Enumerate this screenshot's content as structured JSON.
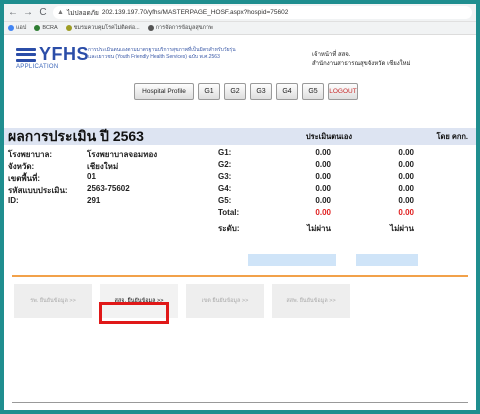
{
  "browser": {
    "nav": [
      "←",
      "→",
      "C"
    ],
    "security": "ไม่ปลอดภัย",
    "url": "202.139.197.70/yfhs/MASTERPAGE_HOSF.aspx?hospid=75602",
    "bookmarks": [
      "แอป",
      "BCRA",
      "ชมรมควบคุมโรคไม่ติดต่อ...",
      "การจัดการข้อมูลสุขภาพ"
    ]
  },
  "header": {
    "logo": "YFHS",
    "logo_sub": "APPLICATION",
    "desc_line1": "การประเมินตนเองตามมาตรฐานบริการสุขภาพที่เป็นมิตรสำหรับวัยรุ่น",
    "desc_line2": "และเยาวชน (Youth Friendly Health Services) ฉบับ พ.ศ.2563",
    "officer_line1": "เจ้าหน้าที่ สสจ.",
    "officer_line2": "สำนักงานสาธารณสุขจังหวัด เชียงใหม่"
  },
  "toolbar": {
    "hospital_profile": "Hospital Profile",
    "g1": "G1",
    "g2": "G2",
    "g3": "G3",
    "g4": "G4",
    "g5": "G5",
    "logout": "LOGOUT"
  },
  "results": {
    "title": "ผลการประเมิน ปี 2563",
    "col_self": "ประเมินตนเอง",
    "col_gov": "โดย คกก.",
    "info": [
      {
        "label": "โรงพยาบาล:",
        "value": "โรงพยาบาลจอมทอง"
      },
      {
        "label": "จังหวัด:",
        "value": "เชียงใหม่"
      },
      {
        "label": "เขตพื้นที่:",
        "value": "01"
      },
      {
        "label": "รหัสแบบประเมิน:",
        "value": "2563-75602"
      },
      {
        "label": "ID:",
        "value": "291"
      }
    ],
    "scores": [
      {
        "label": "G1:",
        "self": "0.00",
        "gov": "0.00"
      },
      {
        "label": "G2:",
        "self": "0.00",
        "gov": "0.00"
      },
      {
        "label": "G3:",
        "self": "0.00",
        "gov": "0.00"
      },
      {
        "label": "G4:",
        "self": "0.00",
        "gov": "0.00"
      },
      {
        "label": "G5:",
        "self": "0.00",
        "gov": "0.00"
      },
      {
        "label": "Total:",
        "self": "0.00",
        "gov": "0.00"
      },
      {
        "label": "ระดับ:",
        "self": "ไม่ผ่าน",
        "gov": "ไม่ผ่าน"
      }
    ]
  },
  "actions": {
    "btn1": "รพ. ยืนยันข้อมูล >>",
    "btn2": "สสจ. ยืนยันข้อมูล >>",
    "btn3": "เขต ยืนยันข้อมูล >>",
    "btn4": "สสพ. ยืนยันข้อมูล >>"
  },
  "colors": {
    "background": "#1f8e8f",
    "accent": "#2b4da8",
    "highlight": "#e01818",
    "divider": "#f2a14a",
    "fail": "#e02020"
  }
}
